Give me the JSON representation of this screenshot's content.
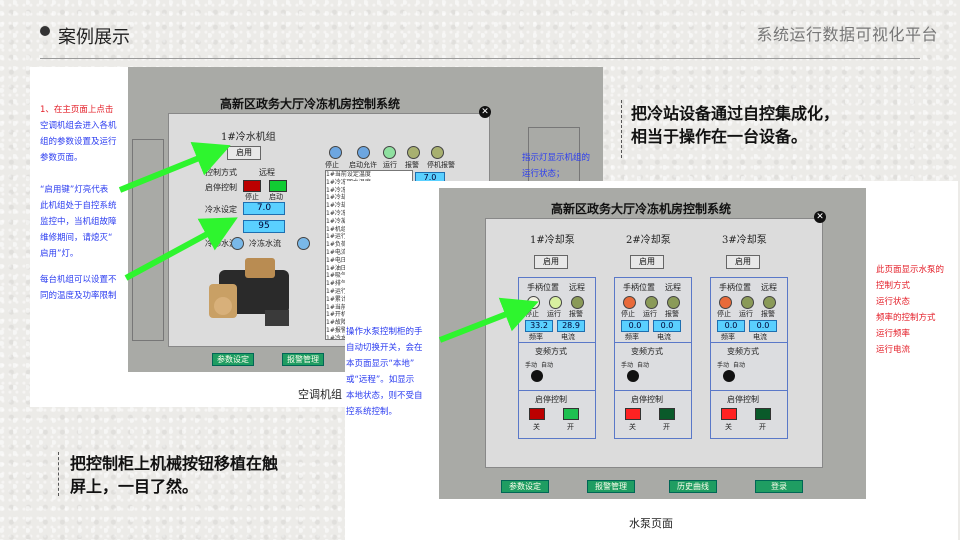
{
  "header": {
    "title": "案例展示",
    "right_title": "系统运行数据可视化平台"
  },
  "callouts": {
    "top": [
      "把冷站设备通过自控集成化，",
      "相当于操作在一台设备。"
    ],
    "bottom": [
      "把控制柜上机械按钮移植在触",
      "屏上，一目了然。"
    ]
  },
  "left_shot": {
    "app_title": "高新区政务大厅冷冻机房控制系统",
    "dialog_title": "1#冷水机组",
    "enable_label": "启用",
    "rows": {
      "ctrl_mode": "控制方式",
      "remote": "远程",
      "start_stop": "启停控制",
      "stop": "停止",
      "start": "启动",
      "chw_set": "冷水设定",
      "chw_set_value": "7.0",
      "power_value": "95",
      "water_flow": "冷却水流",
      "chw_flow": "冷冻水流"
    },
    "status": {
      "stop": "停止",
      "start_allowed": "启动允许",
      "run": "运行",
      "alarm": "报警",
      "shutdown_alarm": "停机报警"
    },
    "readouts": [
      "7.0",
      "95"
    ],
    "list_items": [
      "1#当前设定温度",
      "1#冷冻回水温度",
      "1#冷冻出水温度",
      "1#冷却",
      "1#冷却",
      "1#冷冻",
      "1#冷凝",
      "1#机组",
      "1#运行",
      "1#负荷",
      "1#电流",
      "1#电压",
      "1#油压",
      "1#吸气",
      "1#排气",
      "1#运行",
      "1#累计",
      "1#当前",
      "1#开机",
      "1#故障",
      "1#报警",
      "1#冷水",
      "1#导叶",
      "1#起动",
      "1#运行",
      "1#停机"
    ],
    "nav": [
      "参数设定",
      "报警管理"
    ],
    "caption": "空调机组",
    "annotations": {
      "a1": [
        "1、在主页面上点击",
        "空调机组会进入各机",
        "组的参数设置及运行",
        "参数页面。"
      ],
      "a2": [
        "“启用键”灯亮代表",
        "此机组处于自控系统",
        "监控中，当机组故障",
        "维修期间，请熄灭“",
        "启用”灯。"
      ],
      "a3": [
        "每台机组可以设置不",
        "同的温度及功率限制"
      ],
      "a4": [
        "指示灯显示机组的",
        "运行状态；"
      ]
    }
  },
  "right_shot": {
    "app_title": "高新区政务大厅冷冻机房控制系统",
    "pumps": [
      {
        "name": "1#冷却泵",
        "enable": "启用",
        "hand_pos": "手柄位置",
        "remote": "远程",
        "stop": "停止",
        "run": "运行",
        "fault": "报警",
        "freq": "33.2",
        "current": "28.9",
        "freq_label": "频率",
        "current_label": "电流",
        "vf_mode": "变频方式",
        "manual": "手动",
        "auto": "自动",
        "start_stop": "启停控制",
        "off": "关",
        "on": "开"
      },
      {
        "name": "2#冷却泵",
        "enable": "启用",
        "hand_pos": "手柄位置",
        "remote": "远程",
        "stop": "停止",
        "run": "运行",
        "fault": "报警",
        "freq": "0.0",
        "current": "0.0",
        "freq_label": "频率",
        "current_label": "电流",
        "vf_mode": "变频方式",
        "manual": "手动",
        "auto": "自动",
        "start_stop": "启停控制",
        "off": "关",
        "on": "开"
      },
      {
        "name": "3#冷却泵",
        "enable": "启用",
        "hand_pos": "手柄位置",
        "remote": "远程",
        "stop": "停止",
        "run": "运行",
        "fault": "报警",
        "freq": "0.0",
        "current": "0.0",
        "freq_label": "频率",
        "current_label": "电流",
        "vf_mode": "变频方式",
        "manual": "手动",
        "auto": "自动",
        "start_stop": "启停控制",
        "off": "关",
        "on": "开"
      }
    ],
    "nav": [
      "参数设定",
      "报警管理",
      "历史曲线",
      "登录"
    ],
    "caption": "水泵页面",
    "annotations": {
      "b1": [
        "操作水泵控制柜的手",
        "自动切换开关，会在",
        "本页面显示“本地”",
        "或“远程”。如显示",
        "本地状态，则不受自",
        "控系统控制。"
      ],
      "b2": [
        "此页面显示水泵的",
        "控制方式",
        "运行状态",
        "频率的控制方式",
        "运行频率",
        "运行电流"
      ]
    }
  },
  "colors": {
    "arrow": "#2ef52e",
    "annotation_blue": "#2c3df0",
    "annotation_red": "#e4202a",
    "value_box": "#5ad0ff"
  }
}
